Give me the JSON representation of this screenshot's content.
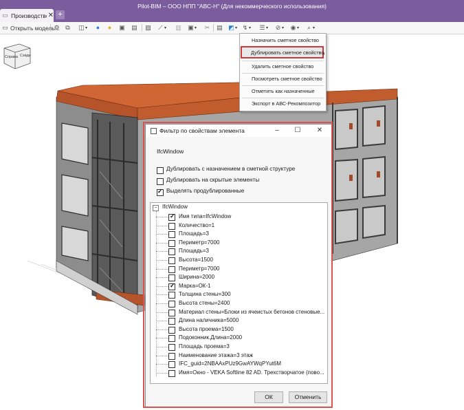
{
  "app": {
    "title": "Pilot-BIM – ООО НПП \"АВС-Н\" (Для некоммерческого использования)",
    "tab_label": "Производственны...",
    "tab_close": "✕",
    "tab_add": "+"
  },
  "toolbar": {
    "open_model_label": "Открыть модель..."
  },
  "view_cube": {
    "front": "Справа",
    "side": "Сзади"
  },
  "context_menu": {
    "items": [
      "Назначить сметное свойство",
      "Дублировать сметное свойство",
      "Удалить сметное свойство",
      "Посмотреть сметное свойство",
      "Отметить как назначенные",
      "Экспорт в АВС-Рекомпозитор"
    ],
    "highlighted_index": 1
  },
  "dialog": {
    "title": "Фильтр по свойствам элемента",
    "subtitle": "IfcWindow",
    "options": [
      {
        "label": "Дублировать с назначением в сметной структуре",
        "checked": false
      },
      {
        "label": "Дублировать  на скрытые элементы",
        "checked": false
      },
      {
        "label": "Выделять продублированные",
        "checked": true
      }
    ],
    "tree": {
      "root": "IfcWindow",
      "items": [
        {
          "label": "Имя типа=IfcWindow",
          "checked": true
        },
        {
          "label": "Количество=1",
          "checked": false
        },
        {
          "label": "Площадь=3",
          "checked": false
        },
        {
          "label": "Периметр=7000",
          "checked": false
        },
        {
          "label": "Площадь=3",
          "checked": false
        },
        {
          "label": "Высота=1500",
          "checked": false
        },
        {
          "label": "Периметр=7000",
          "checked": false
        },
        {
          "label": "Ширина=2000",
          "checked": false
        },
        {
          "label": "Марка=ОК-1",
          "checked": true
        },
        {
          "label": "Толщина стены=300",
          "checked": false
        },
        {
          "label": "Высота стены=2400",
          "checked": false
        },
        {
          "label": "Материал стены=Блоки из ячеистых бетонов стеновые...",
          "checked": false
        },
        {
          "label": "Длина наличника=5000",
          "checked": false
        },
        {
          "label": "Высота проема=1500",
          "checked": false
        },
        {
          "label": "Подоконник.Длина=2000",
          "checked": false
        },
        {
          "label": "Площадь проема=3",
          "checked": false
        },
        {
          "label": "Наименование этажа=3 этаж",
          "checked": false
        },
        {
          "label": "IFC_guid=2NBAAxPUz9GwAYWqPYut6M",
          "checked": false
        },
        {
          "label": "Имя=Окно - VEKA Softline 82 AD. Трехстворчатое (пово...",
          "checked": false
        }
      ]
    },
    "ok_label": "ОК",
    "cancel_label": "Отменить"
  },
  "colors": {
    "titlebar": "#7b5d9d",
    "highlight_border": "#d9534f",
    "roof": "#b5532a",
    "facade_frame": "#4d4d4d",
    "facade_panel": "#c9c9c9"
  }
}
